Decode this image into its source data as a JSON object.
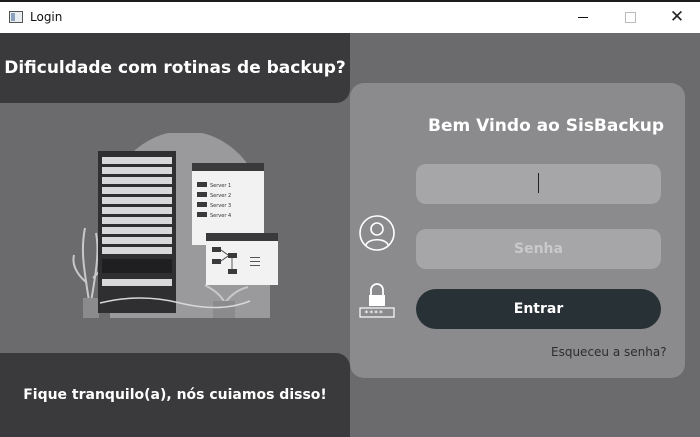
{
  "window": {
    "title": "Login",
    "min_icon": "minimize-icon",
    "max_icon": "maximize-icon",
    "close_icon": "close-icon",
    "close_glyph": "✕"
  },
  "left": {
    "headline": "Dificuldade com rotinas de backup?",
    "tagline": "Fique tranquilo(a), nós cuiamos disso!",
    "illustration": {
      "server_labels": [
        "Server 1",
        "Server 2",
        "Server 3",
        "Server 4"
      ]
    }
  },
  "login": {
    "title": "Bem Vindo ao SisBackup",
    "user_icon": "user-icon",
    "lock_icon": "lock-icon",
    "username_value": "",
    "password_placeholder": "Senha",
    "submit_label": "Entrar",
    "forgot_label": "Esqueceu a senha?"
  },
  "colors": {
    "dark_panel": "#3a3a3c",
    "background": "#6b6b6d",
    "card": "#8b8b8d",
    "field": "#a6a6a8",
    "button": "#283136"
  }
}
